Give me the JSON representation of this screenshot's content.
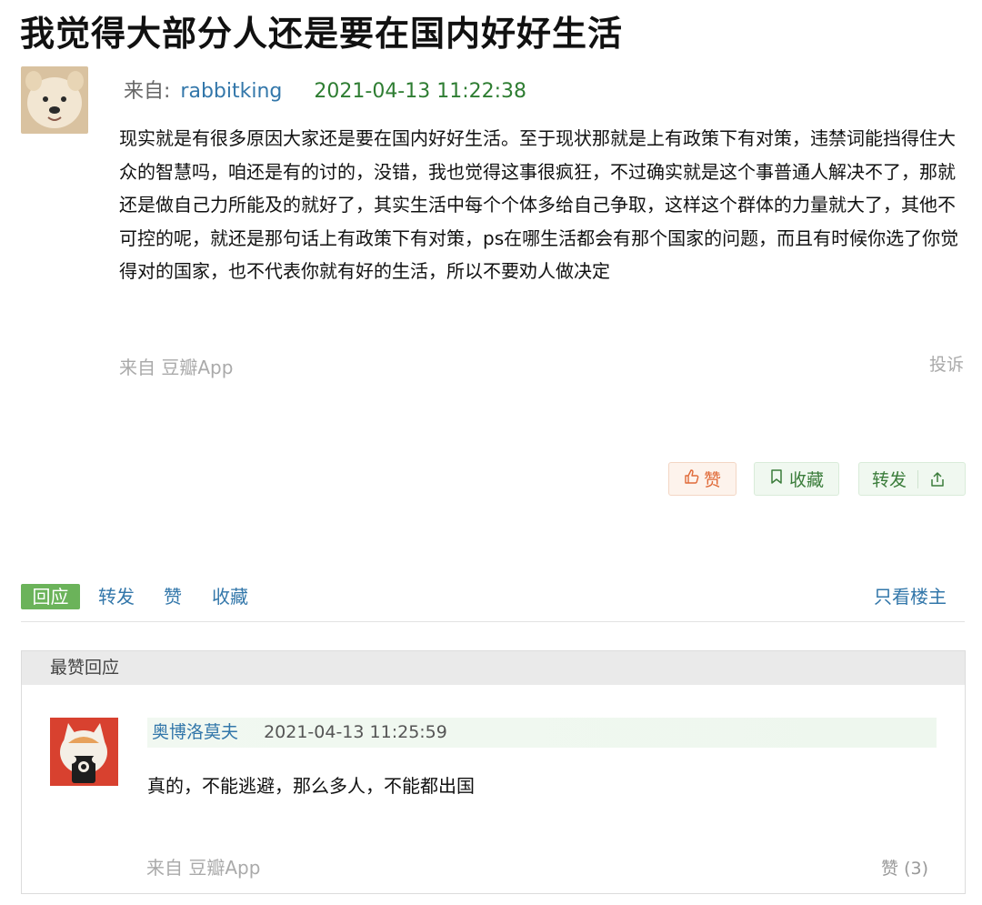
{
  "post": {
    "title": "我觉得大部分人还是要在国内好好生活",
    "author_prefix": "来自:",
    "author": "rabbitking",
    "time": "2021-04-13 11:22:38",
    "body": "现实就是有很多原因大家还是要在国内好好生活。至于现状那就是上有政策下有对策，违禁词能挡得住大众的智慧吗，咱还是有的讨的，没错，我也觉得这事很疯狂，不过确实就是这个事普通人解决不了，那就还是做自己力所能及的就好了，其实生活中每个个体多给自己争取，这样这个群体的力量就大了，其他不可控的呢，就还是那句话上有政策下有对策，ps在哪生活都会有那个国家的问题，而且有时候你选了你觉得对的国家，也不代表你就有好的生活，所以不要劝人做决定",
    "source": "来自 豆瓣App",
    "report": "投诉",
    "like_label": "赞",
    "fav_label": "收藏",
    "share_label": "转发"
  },
  "tabs": {
    "reply": "回应",
    "repost": "转发",
    "like": "赞",
    "collect": "收藏",
    "op_only": "只看楼主"
  },
  "top_replies": {
    "header": "最赞回应",
    "items": [
      {
        "author": "奥博洛莫夫",
        "time": "2021-04-13 11:25:59",
        "text": "真的，不能逃避，那么多人，不能都出国",
        "source": "来自 豆瓣App",
        "likes": "赞 (3)"
      }
    ]
  },
  "icons": {
    "like": "thumbs-up-icon",
    "fav": "bookmark-icon",
    "share": "share-icon"
  },
  "colors": {
    "link": "#3377aa",
    "accent_green": "#6bb35a",
    "time_green": "#2e7d32",
    "like_orange": "#e06a38"
  }
}
